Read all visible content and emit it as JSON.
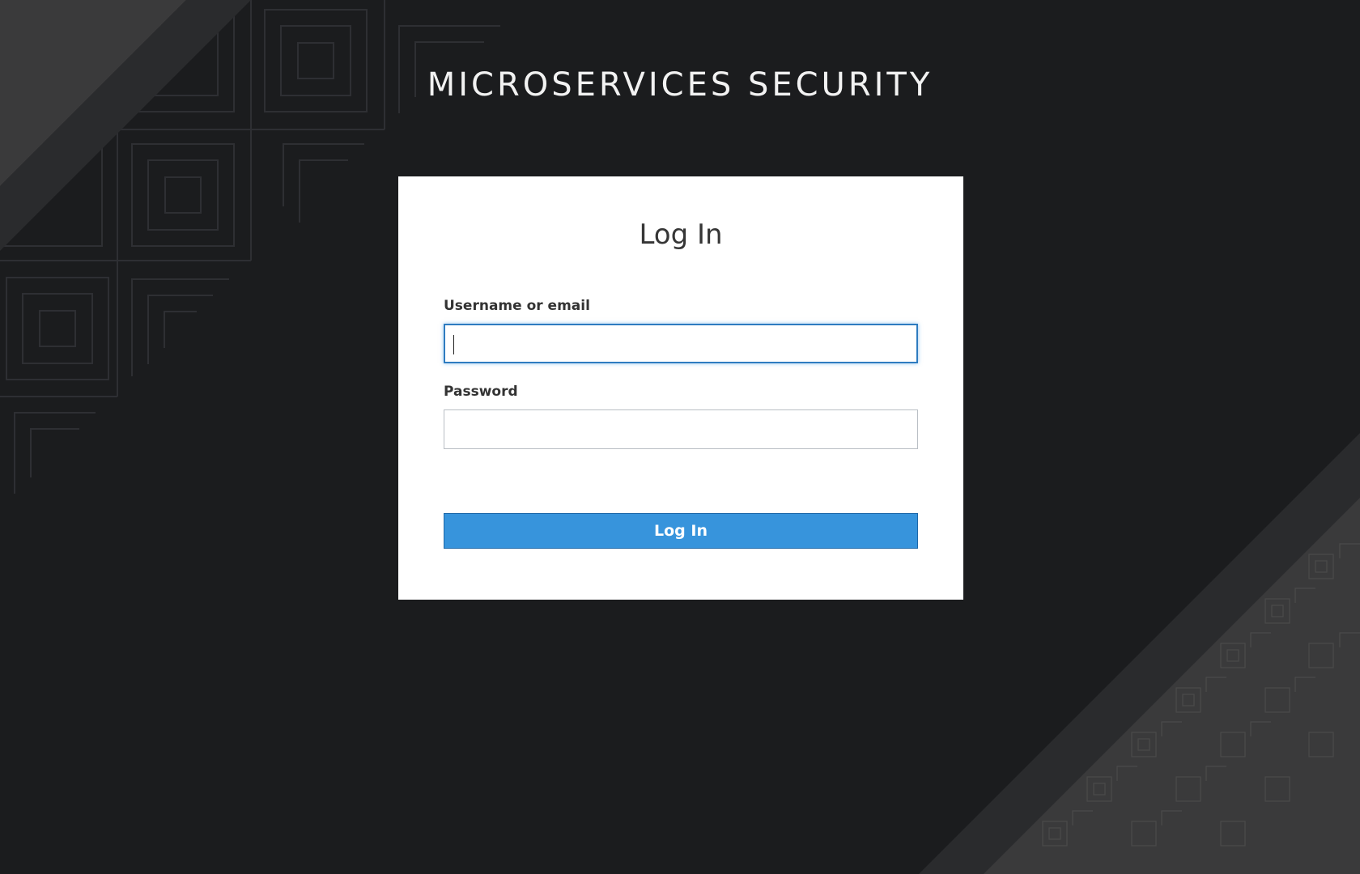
{
  "realm": {
    "title": "MICROSERVICES SECURITY"
  },
  "login_form": {
    "heading": "Log In",
    "username": {
      "label": "Username or email",
      "value": "",
      "focused": true
    },
    "password": {
      "label": "Password",
      "value": ""
    },
    "submit_label": "Log In"
  },
  "colors": {
    "background": "#1b1c1e",
    "stripe_light": "#3a3a3b",
    "stripe_mid": "#2a2b2d",
    "card": "#ffffff",
    "button": "#3794dc",
    "focus_border": "#2e7cc0"
  }
}
